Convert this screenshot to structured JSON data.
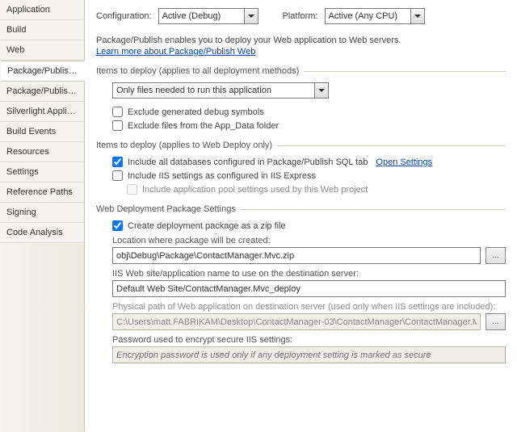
{
  "sidebar": {
    "items": [
      {
        "label": "Application"
      },
      {
        "label": "Build"
      },
      {
        "label": "Web"
      },
      {
        "label": "Package/Publish Web"
      },
      {
        "label": "Package/Publish SQL"
      },
      {
        "label": "Silverlight Applications"
      },
      {
        "label": "Build Events"
      },
      {
        "label": "Resources"
      },
      {
        "label": "Settings"
      },
      {
        "label": "Reference Paths"
      },
      {
        "label": "Signing"
      },
      {
        "label": "Code Analysis"
      }
    ],
    "selected_index": 3
  },
  "top": {
    "configuration_label": "Configuration:",
    "configuration_value": "Active (Debug)",
    "platform_label": "Platform:",
    "platform_value": "Active (Any CPU)"
  },
  "intro": {
    "line1": "Package/Publish enables you to deploy your Web application to Web servers.",
    "learn_link": "Learn more about Package/Publish Web"
  },
  "group_items_all": {
    "title": "Items to deploy (applies to all deployment methods)",
    "deploy_mode": "Only files needed to run this application",
    "exclude_debug": "Exclude generated debug symbols",
    "exclude_appdata": "Exclude files from the App_Data folder"
  },
  "group_items_webdeploy": {
    "title": "Items to deploy (applies to Web Deploy only)",
    "include_db": "Include all databases configured in Package/Publish SQL tab",
    "open_settings": "Open Settings",
    "include_iis": "Include IIS settings as configured in IIS Express",
    "include_apppool": "Include application pool settings used by this Web project"
  },
  "group_pkg": {
    "title": "Web Deployment Package Settings",
    "create_zip": "Create deployment package as a zip file",
    "location_label": "Location where package will be created:",
    "location_value": "obj\\Debug\\Package\\ContactManager.Mvc.zip",
    "iis_name_label": "IIS Web site/application name to use on the destination server:",
    "iis_name_value": "Default Web Site/ContactManager.Mvc_deploy",
    "phys_label": "Physical path of Web application on destination server (used only when IIS settings are included):",
    "phys_value": "C:\\Users\\matt.FABRIKAM\\Desktop\\ContactManager-03\\ContactManager\\ContactManager.Mvc_deploy",
    "pwd_label": "Password used to encrypt secure IIS settings:",
    "pwd_placeholder": "Encryption password is used only if any deployment setting is marked as secure"
  },
  "browse_label": "..."
}
